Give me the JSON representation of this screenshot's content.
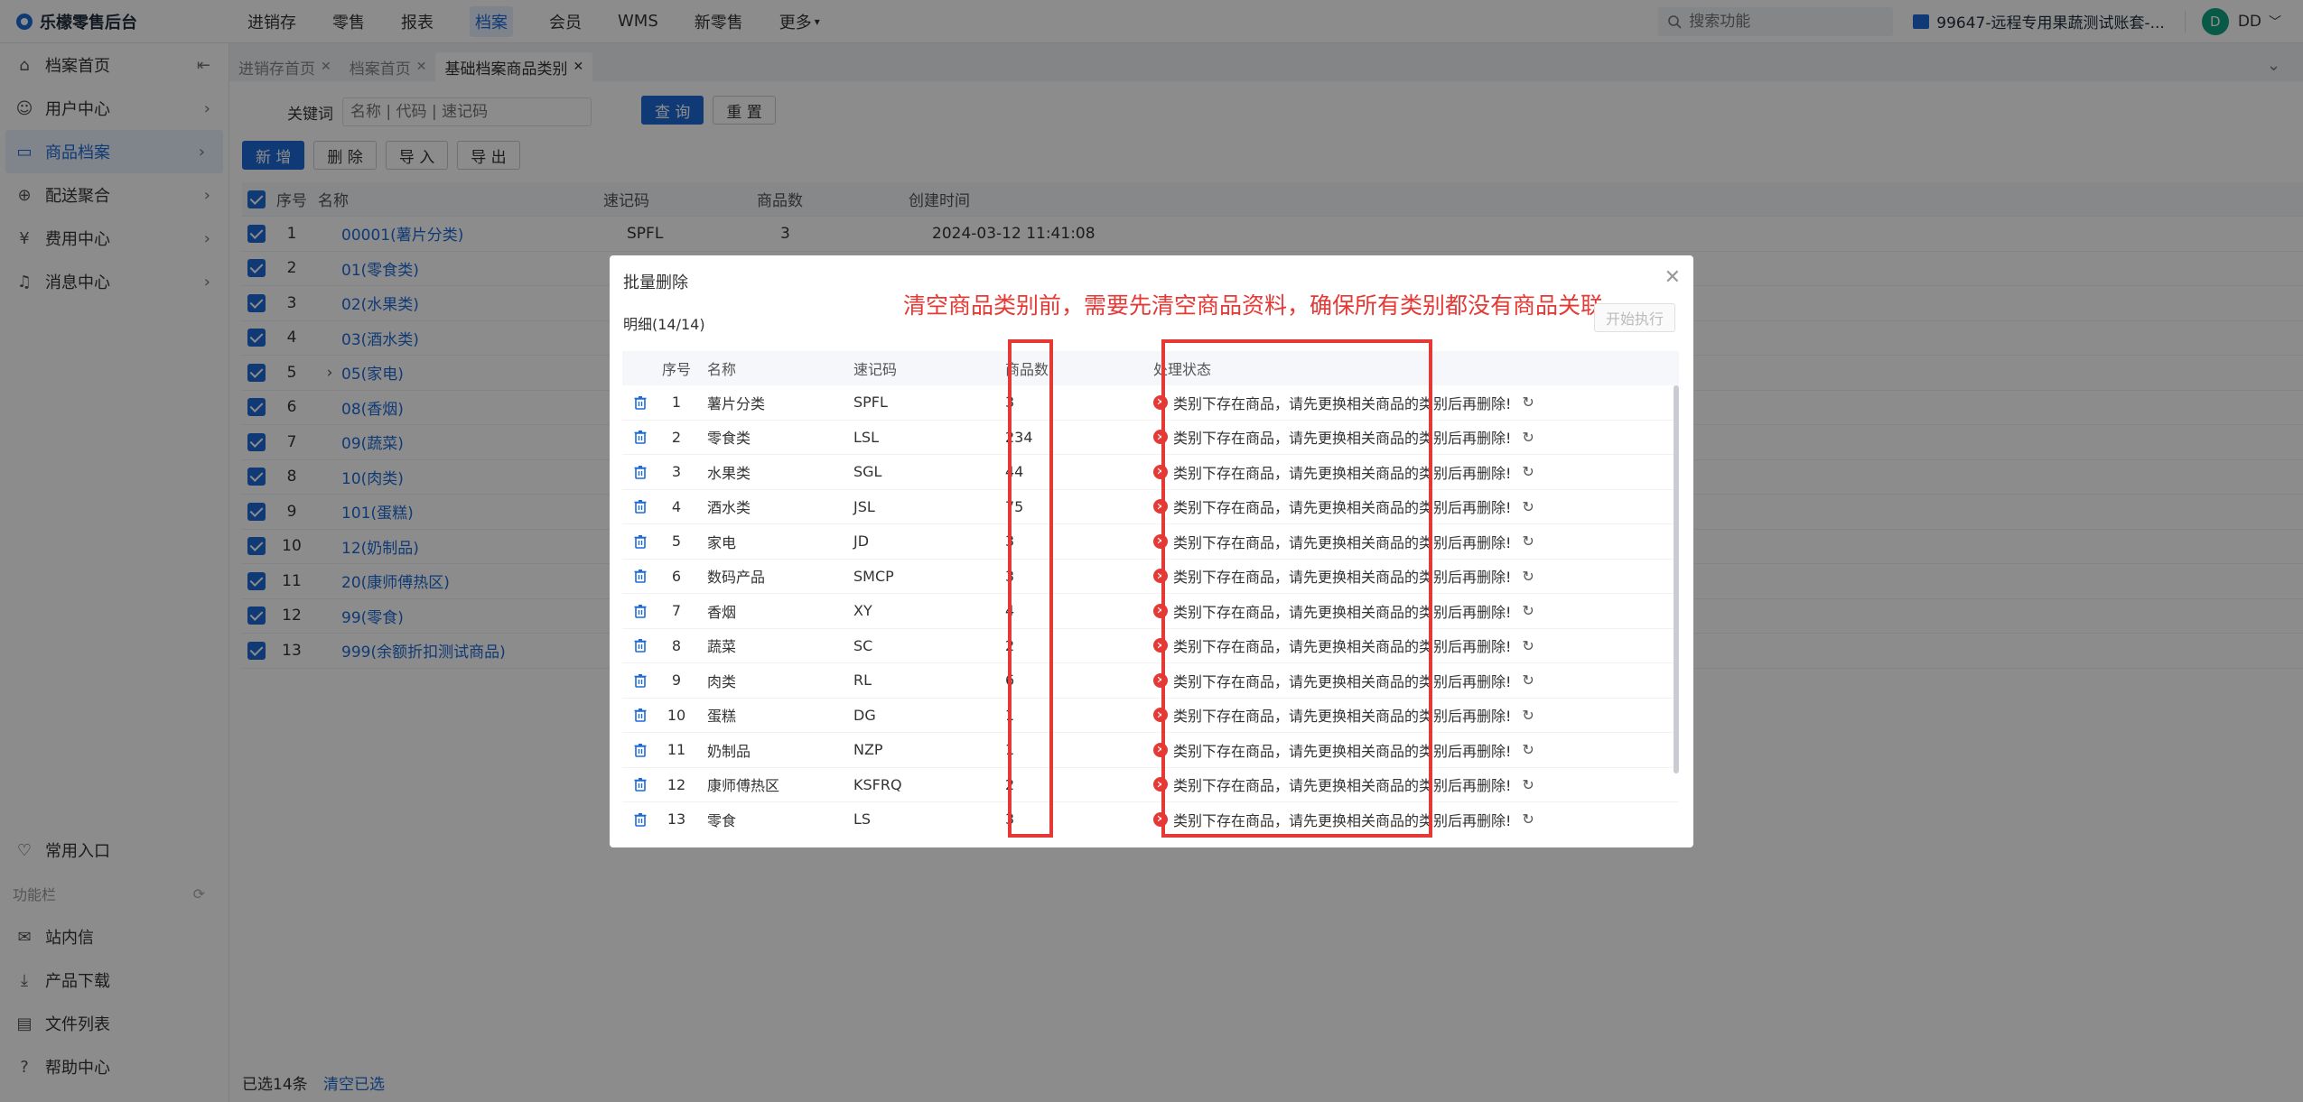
{
  "app": {
    "title": "乐檬零售后台"
  },
  "topnav": [
    {
      "label": "进销存",
      "active": false
    },
    {
      "label": "零售",
      "active": false
    },
    {
      "label": "报表",
      "active": false
    },
    {
      "label": "档案",
      "active": true
    },
    {
      "label": "会员",
      "active": false
    },
    {
      "label": "WMS",
      "active": false
    },
    {
      "label": "新零售",
      "active": false
    },
    {
      "label": "更多",
      "active": false
    }
  ],
  "top_search": {
    "placeholder": "搜索功能"
  },
  "account": {
    "label": "99647-远程专用果蔬测试账套-..."
  },
  "user": {
    "initial": "D",
    "name": "DD"
  },
  "sidebar": {
    "items": [
      {
        "label": "档案首页",
        "icon": "home-icon",
        "active": false
      },
      {
        "label": "用户中心",
        "icon": "user-icon",
        "active": false
      },
      {
        "label": "商品档案",
        "icon": "box-icon",
        "active": true
      },
      {
        "label": "配送聚合",
        "icon": "delivery-icon",
        "active": false
      },
      {
        "label": "费用中心",
        "icon": "fee-icon",
        "active": false
      },
      {
        "label": "消息中心",
        "icon": "bell-icon",
        "active": false
      }
    ],
    "favorite": "常用入口",
    "group_title": "功能栏",
    "tools": [
      {
        "label": "站内信",
        "icon": "mail-icon"
      },
      {
        "label": "产品下载",
        "icon": "download-icon"
      },
      {
        "label": "文件列表",
        "icon": "file-icon"
      },
      {
        "label": "帮助中心",
        "icon": "help-icon"
      }
    ]
  },
  "tabs": [
    {
      "label": "进销存首页",
      "active": false
    },
    {
      "label": "档案首页",
      "active": false
    },
    {
      "label": "基础档案商品类别",
      "active": true
    }
  ],
  "filter": {
    "label": "关键词",
    "placeholder": "名称 | 代码 | 速记码",
    "search": "查 询",
    "reset": "重 置"
  },
  "toolbar": {
    "add": "新 增",
    "delete": "删 除",
    "import": "导 入",
    "export": "导 出"
  },
  "grid": {
    "headers": {
      "seq": "序号",
      "name": "名称",
      "code": "速记码",
      "count": "商品数",
      "time": "创建时间"
    },
    "rows": [
      {
        "seq": "1",
        "name": "00001(薯片分类)",
        "code": "SPFL",
        "count": "3",
        "time": "2024-03-12 11:41:08",
        "expand": ""
      },
      {
        "seq": "2",
        "name": "01(零食类)",
        "code": "",
        "count": "",
        "time": "",
        "expand": ""
      },
      {
        "seq": "3",
        "name": "02(水果类)",
        "code": "",
        "count": "",
        "time": "",
        "expand": ""
      },
      {
        "seq": "4",
        "name": "03(酒水类)",
        "code": "",
        "count": "",
        "time": "",
        "expand": ""
      },
      {
        "seq": "5",
        "name": "05(家电)",
        "code": "",
        "count": "",
        "time": "",
        "expand": "›"
      },
      {
        "seq": "6",
        "name": "08(香烟)",
        "code": "",
        "count": "",
        "time": "",
        "expand": ""
      },
      {
        "seq": "7",
        "name": "09(蔬菜)",
        "code": "",
        "count": "",
        "time": "",
        "expand": ""
      },
      {
        "seq": "8",
        "name": "10(肉类)",
        "code": "",
        "count": "",
        "time": "",
        "expand": ""
      },
      {
        "seq": "9",
        "name": "101(蛋糕)",
        "code": "",
        "count": "",
        "time": "",
        "expand": ""
      },
      {
        "seq": "10",
        "name": "12(奶制品)",
        "code": "",
        "count": "",
        "time": "",
        "expand": ""
      },
      {
        "seq": "11",
        "name": "20(康师傅热区)",
        "code": "",
        "count": "",
        "time": "",
        "expand": ""
      },
      {
        "seq": "12",
        "name": "99(零食)",
        "code": "",
        "count": "",
        "time": "",
        "expand": ""
      },
      {
        "seq": "13",
        "name": "999(余额折扣测试商品)",
        "code": "",
        "count": "",
        "time": "",
        "expand": ""
      }
    ]
  },
  "footer": {
    "selected": "已选14条",
    "clear": "清空已选"
  },
  "dialog": {
    "title": "批量删除",
    "subtitle": "明细(14/14)",
    "exec_button": "开始执行",
    "annotation": "清空商品类别前，需要先清空商品资料，确保所有类别都没有商品关联",
    "headers": {
      "seq": "序号",
      "name": "名称",
      "code": "速记码",
      "count": "商品数",
      "status": "处理状态"
    },
    "status_text": "类别下存在商品，请先更换相关商品的类别后再删除!",
    "rows": [
      {
        "seq": "1",
        "name": "薯片分类",
        "code": "SPFL",
        "count": "3"
      },
      {
        "seq": "2",
        "name": "零食类",
        "code": "LSL",
        "count": "234"
      },
      {
        "seq": "3",
        "name": "水果类",
        "code": "SGL",
        "count": "44"
      },
      {
        "seq": "4",
        "name": "酒水类",
        "code": "JSL",
        "count": "75"
      },
      {
        "seq": "5",
        "name": "家电",
        "code": "JD",
        "count": "3"
      },
      {
        "seq": "6",
        "name": "数码产品",
        "code": "SMCP",
        "count": "3"
      },
      {
        "seq": "7",
        "name": "香烟",
        "code": "XY",
        "count": "4"
      },
      {
        "seq": "8",
        "name": "蔬菜",
        "code": "SC",
        "count": "2"
      },
      {
        "seq": "9",
        "name": "肉类",
        "code": "RL",
        "count": "6"
      },
      {
        "seq": "10",
        "name": "蛋糕",
        "code": "DG",
        "count": "1"
      },
      {
        "seq": "11",
        "name": "奶制品",
        "code": "NZP",
        "count": "1"
      },
      {
        "seq": "12",
        "name": "康师傅热区",
        "code": "KSFRQ",
        "count": "2"
      },
      {
        "seq": "13",
        "name": "零食",
        "code": "LS",
        "count": "3"
      }
    ]
  },
  "colors": {
    "primary": "#1e6bd6",
    "error": "#e53935",
    "annotation": "#e53935"
  }
}
